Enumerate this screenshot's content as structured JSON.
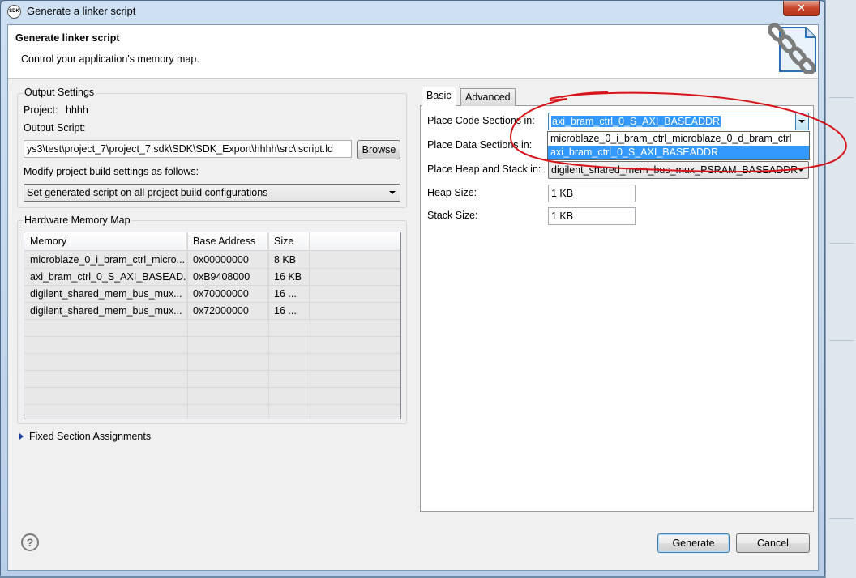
{
  "window": {
    "title": "Generate a linker script",
    "icon_label": "SDK",
    "close_symbol": "✕"
  },
  "header": {
    "title": "Generate linker script",
    "subtitle": "Control your application's memory map.",
    "icon": "chain-link-document-icon"
  },
  "output_settings": {
    "group_label": "Output Settings",
    "project_label": "Project:",
    "project_value": "hhhh",
    "output_script_label": "Output Script:",
    "output_script_value": "ys3\\test\\project_7\\project_7.sdk\\SDK\\SDK_Export\\hhhh\\src\\lscript.ld",
    "browse_label": "Browse",
    "modify_label": "Modify project build settings as follows:",
    "modify_value": "Set generated script on all project build configurations"
  },
  "memory_map": {
    "group_label": "Hardware Memory Map",
    "columns": [
      "Memory",
      "Base Address",
      "Size"
    ],
    "rows": [
      {
        "memory": "microblaze_0_i_bram_ctrl_micro...",
        "base": "0x00000000",
        "size": "8 KB"
      },
      {
        "memory": "axi_bram_ctrl_0_S_AXI_BASEAD...",
        "base": "0xB9408000",
        "size": "16 KB"
      },
      {
        "memory": "digilent_shared_mem_bus_mux...",
        "base": "0x70000000",
        "size": "16 ..."
      },
      {
        "memory": "digilent_shared_mem_bus_mux...",
        "base": "0x72000000",
        "size": "16 ..."
      }
    ]
  },
  "fixed_sections": {
    "label": "Fixed Section Assignments"
  },
  "tabs": [
    {
      "label": "Basic",
      "active": true
    },
    {
      "label": "Advanced",
      "active": false
    }
  ],
  "basic": {
    "code_label": "Place Code Sections in:",
    "code_value": "axi_bram_ctrl_0_S_AXI_BASEADDR",
    "data_label": "Place Data Sections in:",
    "heap_stack_label": "Place Heap and Stack in:",
    "heap_stack_value": "digilent_shared_mem_bus_mux_PSRAM_BASEADDR",
    "heap_size_label": "Heap Size:",
    "heap_size_value": "1 KB",
    "stack_size_label": "Stack Size:",
    "stack_size_value": "1 KB",
    "dropdown_options": [
      "microblaze_0_i_bram_ctrl_microblaze_0_d_bram_ctrl",
      "axi_bram_ctrl_0_S_AXI_BASEADDR"
    ],
    "dropdown_selected_index": 1
  },
  "footer": {
    "help_symbol": "?",
    "generate_label": "Generate",
    "cancel_label": "Cancel"
  },
  "colors": {
    "selection": "#3399ff",
    "annotation": "#d8141b"
  }
}
